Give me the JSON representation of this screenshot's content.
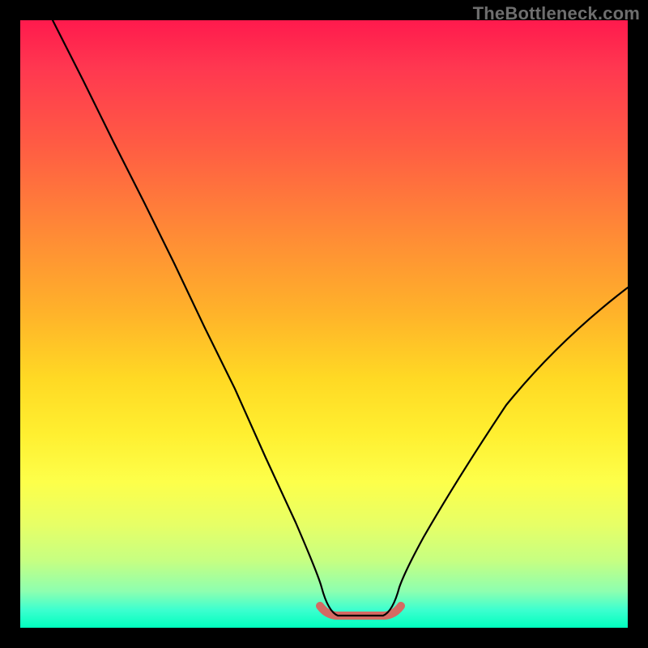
{
  "watermark": "TheBottleneck.com",
  "colors": {
    "gradient_top": "#ff1a4d",
    "gradient_bottom": "#00ffbf",
    "curve": "#000000",
    "marker": "#d46a63",
    "frame": "#000000"
  },
  "chart_data": {
    "type": "line",
    "title": "",
    "xlabel": "",
    "ylabel": "",
    "xlim": [
      0,
      1
    ],
    "ylim": [
      0,
      1
    ],
    "x": [
      0.0,
      0.05,
      0.1,
      0.15,
      0.2,
      0.25,
      0.3,
      0.35,
      0.4,
      0.45,
      0.5,
      0.52,
      0.55,
      0.58,
      0.6,
      0.62,
      0.65,
      0.7,
      0.75,
      0.8,
      0.85,
      0.9,
      0.95,
      1.0
    ],
    "values": [
      1.0,
      0.9,
      0.8,
      0.7,
      0.6,
      0.49,
      0.39,
      0.28,
      0.18,
      0.09,
      0.03,
      0.02,
      0.02,
      0.02,
      0.02,
      0.03,
      0.05,
      0.1,
      0.17,
      0.25,
      0.33,
      0.41,
      0.49,
      0.56
    ],
    "marker_region_x": [
      0.5,
      0.62
    ],
    "marker_region_y": 0.02,
    "annotations": []
  }
}
